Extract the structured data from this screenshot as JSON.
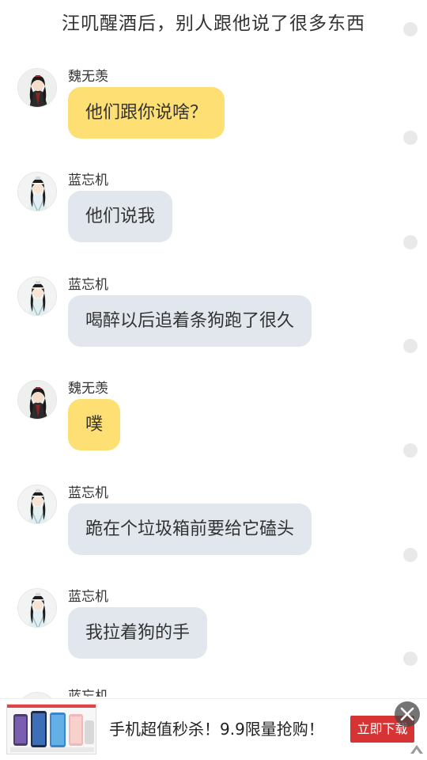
{
  "header": {
    "title": "汪叽醒酒后，别人跟他说了很多东西"
  },
  "messages": [
    {
      "sender": "魏无羡",
      "text": "他们跟你说啥？",
      "style": "yellow",
      "avatar_icon": "wei-wuxian-avatar"
    },
    {
      "sender": "蓝忘机",
      "text": "他们说我",
      "style": "grey",
      "avatar_icon": "lan-wangji-avatar"
    },
    {
      "sender": "蓝忘机",
      "text": "喝醉以后追着条狗跑了很久",
      "style": "grey",
      "avatar_icon": "lan-wangji-avatar"
    },
    {
      "sender": "魏无羡",
      "text": "噗",
      "style": "yellow",
      "avatar_icon": "wei-wuxian-avatar"
    },
    {
      "sender": "蓝忘机",
      "text": "跪在个垃圾箱前要给它磕头",
      "style": "grey",
      "avatar_icon": "lan-wangji-avatar"
    },
    {
      "sender": "蓝忘机",
      "text": "我拉着狗的手",
      "style": "grey",
      "avatar_icon": "lan-wangji-avatar"
    }
  ],
  "partial_message": {
    "sender": "蓝忘机"
  },
  "ad": {
    "text": "手机超值秒杀！9.9限量抢购！",
    "button_label": "立即下载",
    "thumbnail_icon": "phones-thumbnail",
    "close_icon": "close-icon"
  },
  "colors": {
    "bubble_yellow": "#fedf74",
    "bubble_grey": "#e1e7ed",
    "ad_button": "#d63434"
  }
}
